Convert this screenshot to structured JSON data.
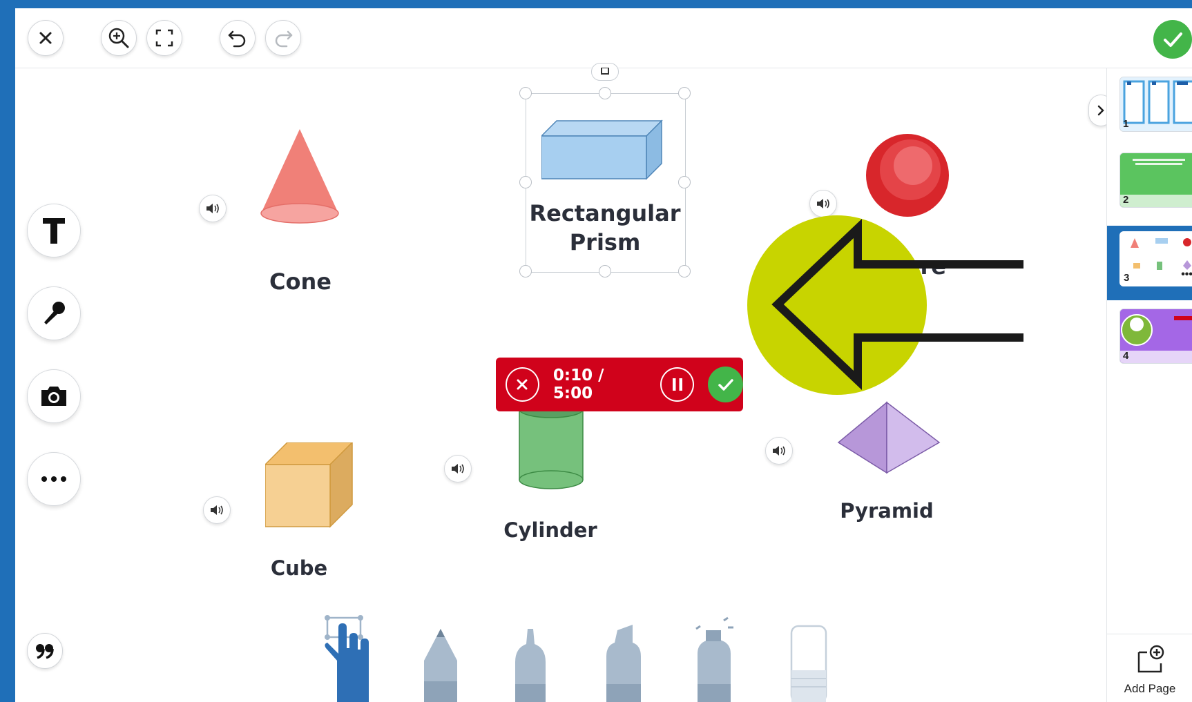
{
  "toolbar": {
    "close_icon": "close-icon",
    "zoom_icon": "zoom-in-icon",
    "fullscreen_icon": "fullscreen-icon",
    "undo_icon": "undo-icon",
    "redo_icon": "redo-icon",
    "done_icon": "checkmark-icon",
    "done_color": "#43b549"
  },
  "side_tools": [
    "text-tool",
    "microphone-tool",
    "camera-tool",
    "more-tool",
    "quote-tool"
  ],
  "shapes": {
    "cone": "Cone",
    "rect_prism_line1": "Rectangular",
    "rect_prism_line2": "Prism",
    "sphere": "here",
    "cube": "Cube",
    "cylinder": "Cylinder",
    "pyramid": "Pyramid"
  },
  "recorder": {
    "time": "0:10 / 5:00",
    "color": "#d0021b"
  },
  "annotation": {
    "circle_color": "#c8d400"
  },
  "pages": [
    {
      "number": "1"
    },
    {
      "number": "2"
    },
    {
      "number": "3",
      "selected": true
    },
    {
      "number": "4"
    }
  ],
  "panel": {
    "add_page_label": "Add Page"
  },
  "bottom_tools": [
    "select-hand",
    "pencil",
    "pen",
    "marker",
    "spray",
    "eraser"
  ]
}
